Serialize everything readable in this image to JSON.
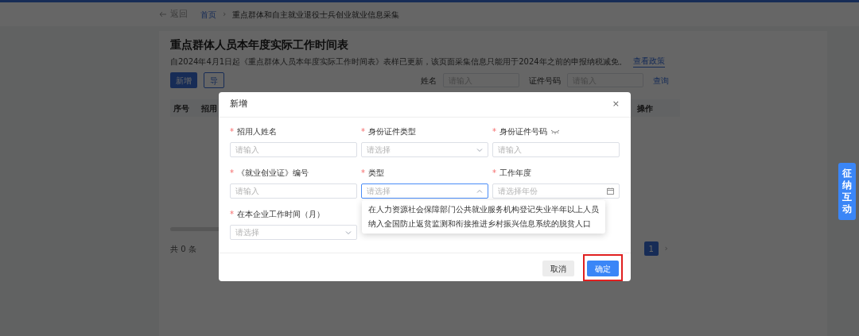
{
  "header": {
    "back": "返回",
    "home": "首页",
    "separator": "›",
    "current": "重点群体和自主就业退役士兵创业就业信息采集"
  },
  "page": {
    "title": "重点群体人员本年度实际工作时间表",
    "notice": "自2024年4月1日起《重点群体人员本年度实际工作时间表》表样已更新，该页面采集信息只能用于2024年之前的申报纳税减免。",
    "notice_link": "查看政策",
    "actions": [
      {
        "label": "新增",
        "kind": "primary"
      },
      {
        "label": "导",
        "kind": "outline"
      }
    ],
    "filters": [
      {
        "label": "姓名",
        "placeholder": "请输入"
      },
      {
        "label": "证件号码",
        "placeholder": "请输入"
      }
    ],
    "search_link": "查询",
    "table": {
      "columns": [
        "序号",
        "招用",
        "操作"
      ]
    },
    "pagination": {
      "total": "共 0 条",
      "pages": [
        {
          "label": "1",
          "selected": true
        }
      ],
      "next": "›"
    }
  },
  "dialog": {
    "title": "新增",
    "close": "×",
    "fields": [
      {
        "required_mark": "*",
        "label": "招用人姓名",
        "kind": "input",
        "placeholder": "请输入",
        "open": false,
        "visibility_toggle": false
      },
      {
        "required_mark": "*",
        "label": "身份证件类型",
        "kind": "select",
        "placeholder": "请选择",
        "open": false,
        "visibility_toggle": false
      },
      {
        "required_mark": "*",
        "label": "身份证件号码",
        "kind": "input",
        "placeholder": "请输入",
        "open": false,
        "visibility_toggle": true
      },
      {
        "required_mark": "*",
        "label": "《就业创业证》编号",
        "kind": "input",
        "placeholder": "请输入",
        "open": false,
        "visibility_toggle": false
      },
      {
        "required_mark": "*",
        "label": "类型",
        "kind": "select",
        "placeholder": "请选择",
        "open": true,
        "visibility_toggle": false
      },
      {
        "required_mark": "*",
        "label": "工作年度",
        "kind": "date",
        "placeholder": "请选择年份",
        "open": false,
        "visibility_toggle": false
      },
      {
        "required_mark": "*",
        "label": "在本企业工作时间（月）",
        "kind": "select",
        "placeholder": "请选择",
        "open": false,
        "visibility_toggle": false
      }
    ],
    "options": [
      "在人力资源社会保障部门公共就业服务机构登记失业半年以上人员",
      "纳入全国防止返贫监测和衔接推进乡村振兴信息系统的脱贫人口"
    ],
    "buttons": [
      {
        "label": "取消",
        "kind": "default",
        "highlighted": false
      },
      {
        "label": "确定",
        "kind": "primary",
        "highlighted": true
      }
    ]
  },
  "side_tab": "征纳互动"
}
